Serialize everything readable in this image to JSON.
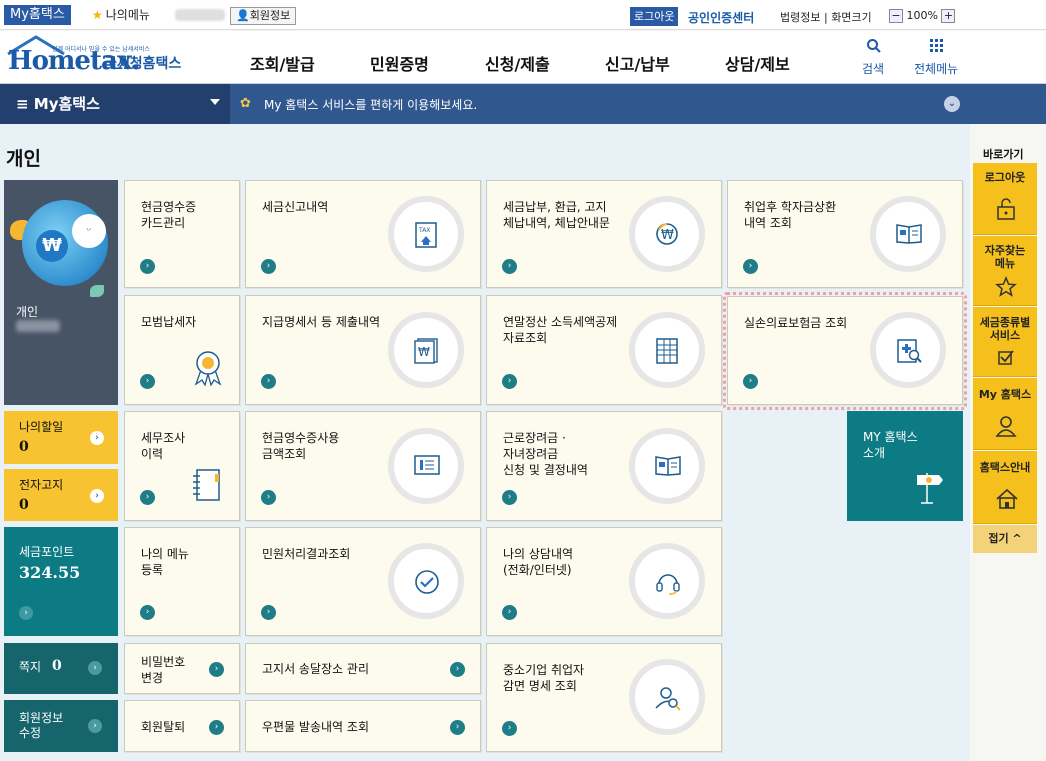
{
  "topbar": {
    "myhome_tab": "My홈택스",
    "my_menu": "나의메뉴",
    "member_info": "회원정보",
    "logout": "로그아웃",
    "cert_center": "공인인증센터",
    "law_info": "법령정보",
    "screen_size": "화면크기",
    "zoom": "100%"
  },
  "header": {
    "logo_text": "Hometax.",
    "logo_sub": "언제 어디서나 믿을 수 있는 납세서비스",
    "logo_kr": "국세청홈택스",
    "nav": [
      "조회/발급",
      "민원증명",
      "신청/제출",
      "신고/납부",
      "상담/제보"
    ],
    "search": "검색",
    "all_menu": "전체메뉴"
  },
  "bar": {
    "dropdown": "≡  My홈택스",
    "message": "My 홈택스 서비스를 편하게 이용해보세요."
  },
  "page": {
    "title": "개인"
  },
  "profile": {
    "label": "개인"
  },
  "side": {
    "todo_label": "나의할일",
    "todo_value": "0",
    "notice_label": "전자고지",
    "notice_value": "0",
    "points_label": "세금포인트",
    "points_value": "324.55",
    "message_label": "쪽지",
    "message_value": "0",
    "member_edit": "회원정보\n수정"
  },
  "cards": {
    "cash_receipt": "현금영수증\n카드관리",
    "tax_report": "세금신고내역",
    "tax_payment": "세금납부, 환급, 고지\n체납내역, 체납안내문",
    "student_loan": "취업후 학자금상환\n내역 조회",
    "model_taxpayer": "모범납세자",
    "payment_statement": "지급명세서 등 제출내역",
    "year_end": "연말정산 소득세액공제\n자료조회",
    "medical_insurance": "실손의료보험금 조회",
    "audit_history": "세무조사\n이력",
    "cash_usage": "현금영수증사용\n금액조회",
    "eitc": "근로장려금 ·\n자녀장려금\n신청 및 결정내역",
    "my_intro": "MY 홈택스\n소개",
    "my_menu_reg": "나의 메뉴\n등록",
    "petition_result": "민원처리결과조회",
    "consult_history": "나의 상담내역\n(전화/인터넷)",
    "password_change": "비밀번호\n변경",
    "notice_place": "고지서 송달장소 관리",
    "sme_tax": "중소기업 취업자\n감면 명세 조회",
    "withdraw": "회원탈퇴",
    "mail_history": "우편물 발송내역 조회"
  },
  "rail": {
    "title": "바로가기",
    "logout": "로그아웃",
    "favorites": "자주찾는\n메뉴",
    "tax_services": "세금종류별\n서비스",
    "my_hometax": "My 홈택스",
    "guide": "홈택스안내",
    "collapse": "접기 ^"
  },
  "colors": {
    "brand_blue": "#1b5aa8",
    "bar_blue": "#31578f",
    "teal": "#0d7b84",
    "yellow": "#f7c331",
    "highlight": "#f1a1a6"
  }
}
